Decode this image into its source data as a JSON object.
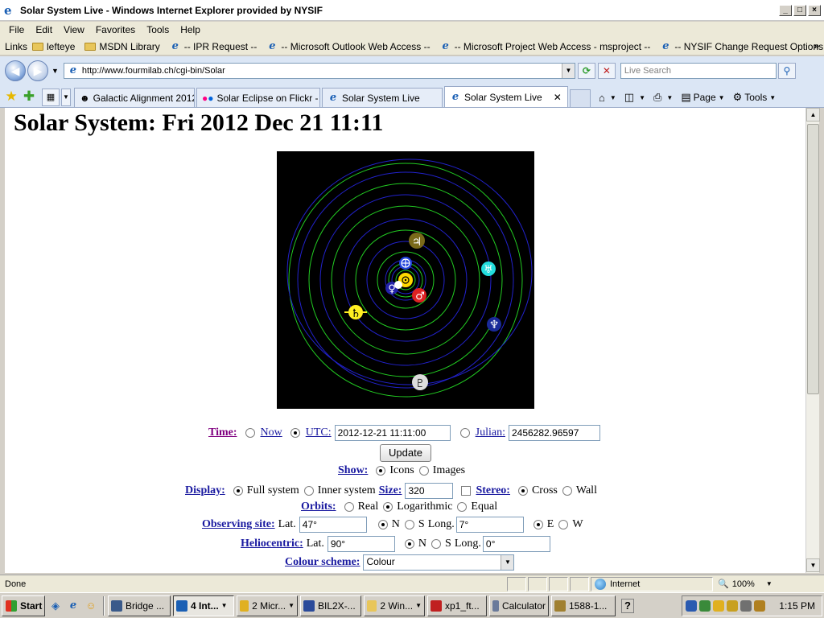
{
  "window": {
    "title": "Solar System Live - Windows Internet Explorer provided by NYSIF"
  },
  "menu": [
    "File",
    "Edit",
    "View",
    "Favorites",
    "Tools",
    "Help"
  ],
  "links_bar": {
    "label": "Links",
    "items": [
      {
        "icon": "folder",
        "label": "lefteye"
      },
      {
        "icon": "folder",
        "label": "MSDN Library"
      },
      {
        "icon": "ie",
        "label": "-- IPR Request --"
      },
      {
        "icon": "ie",
        "label": "-- Microsoft Outlook Web Access --"
      },
      {
        "icon": "ie",
        "label": "-- Microsoft Project Web Access - msproject --"
      },
      {
        "icon": "ie",
        "label": "-- NYSIF Change Request Options --"
      }
    ]
  },
  "address": {
    "url": "http://www.fourmilab.ch/cgi-bin/Solar",
    "search_placeholder": "Live Search"
  },
  "tabs": [
    {
      "label": "Galactic Alignment 2012...",
      "active": false
    },
    {
      "label": "Solar Eclipse on Flickr - ...",
      "active": false
    },
    {
      "label": "Solar System Live",
      "active": false
    },
    {
      "label": "Solar System Live",
      "active": true
    }
  ],
  "command_bar": {
    "page": "Page",
    "tools": "Tools"
  },
  "page": {
    "title": "Solar System: Fri 2012 Dec 21 11:11",
    "form": {
      "time": {
        "label": "Time:",
        "now": "Now",
        "utc": "UTC:",
        "utc_value": "2012-12-21 11:11:00",
        "julian": "Julian:",
        "julian_value": "2456282.96597",
        "selected": "utc"
      },
      "update_button": "Update",
      "show": {
        "label": "Show:",
        "icons": "Icons",
        "images": "Images",
        "selected": "icons"
      },
      "display": {
        "label": "Display:",
        "full": "Full system",
        "inner": "Inner system",
        "size_label": "Size:",
        "size_value": "320",
        "stereo_label": "Stereo:",
        "cross": "Cross",
        "wall": "Wall",
        "selected": "full",
        "stereo_selected": "cross"
      },
      "orbits": {
        "label": "Orbits:",
        "real": "Real",
        "logarithmic": "Logarithmic",
        "equal": "Equal",
        "selected": "logarithmic"
      },
      "observing": {
        "label": "Observing site:",
        "lat": "Lat.",
        "lat_value": "47°",
        "n": "N",
        "s": "S",
        "long": "Long.",
        "long_value": "7°",
        "e": "E",
        "w": "W"
      },
      "heliocentric": {
        "label": "Heliocentric:",
        "lat": "Lat.",
        "lat_value": "90°",
        "n": "N",
        "s": "S",
        "long": "Long.",
        "long_value": "0°"
      },
      "colour": {
        "label": "Colour scheme:",
        "value": "Colour"
      }
    },
    "orrery": {
      "colors": {
        "background": "#000000",
        "orbit_green": "#22cc22",
        "orbit_blue": "#2222cc"
      },
      "planets": [
        {
          "name": "sun",
          "symbol": "⊙",
          "color": "#ffd700"
        },
        {
          "name": "mercury",
          "symbol": "☿",
          "color": "#ffffff"
        },
        {
          "name": "venus",
          "symbol": "♀",
          "color": "#ffffff"
        },
        {
          "name": "earth",
          "symbol": "⊕",
          "color": "#2244dd"
        },
        {
          "name": "mars",
          "symbol": "♂",
          "color": "#dd2222"
        },
        {
          "name": "jupiter",
          "symbol": "♃",
          "color": "#7a6a1a"
        },
        {
          "name": "saturn",
          "symbol": "♄",
          "color": "#ffee22"
        },
        {
          "name": "uranus",
          "symbol": "♅",
          "color": "#22dddd"
        },
        {
          "name": "neptune",
          "symbol": "♆",
          "color": "#1a2a99"
        },
        {
          "name": "pluto",
          "symbol": "♇",
          "color": "#dddddd"
        }
      ]
    }
  },
  "status": {
    "text": "Done",
    "zone": "Internet",
    "zoom": "100%"
  },
  "taskbar": {
    "start": "Start",
    "items": [
      {
        "label": "Bridge ...",
        "active": false,
        "color": "#3a5a8a"
      },
      {
        "label": "4 Int...",
        "active": true,
        "color": "#1a5fb4"
      },
      {
        "label": "2 Micr...",
        "active": false,
        "color": "#e0b020"
      },
      {
        "label": "BIL2X-...",
        "active": false,
        "color": "#2a4a9a"
      },
      {
        "label": "2 Win...",
        "active": false,
        "color": "#e8c65a"
      },
      {
        "label": "xp1_ft...",
        "active": false,
        "color": "#c02020"
      },
      {
        "label": "Calculator",
        "active": false,
        "color": "#6a7a9a"
      },
      {
        "label": "1588-1...",
        "active": false,
        "color": "#a08030"
      }
    ],
    "clock": "1:15 PM"
  }
}
